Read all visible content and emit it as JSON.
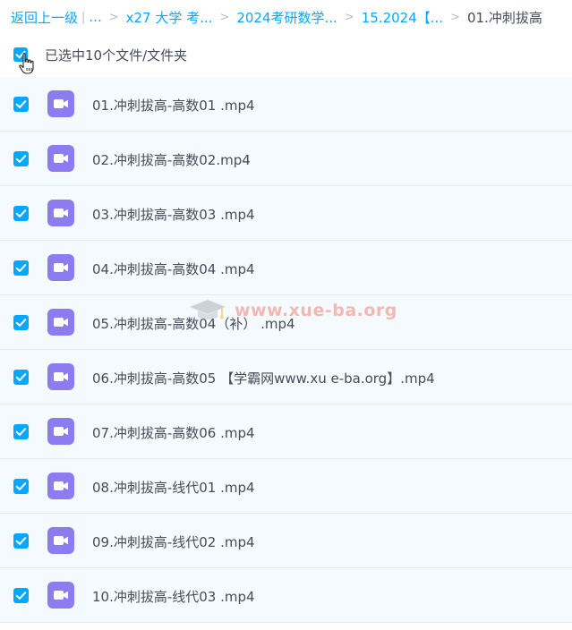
{
  "breadcrumb": {
    "items": [
      {
        "label": "返回上一级"
      },
      {
        "label": "..."
      },
      {
        "label": "x27 大学 考..."
      },
      {
        "label": "2024考研数学..."
      },
      {
        "label": "15.2024【..."
      }
    ],
    "pipe": "|",
    "separator": ">",
    "current": "01.冲刺拔高"
  },
  "selection": {
    "text": "已选中10个文件/文件夹",
    "checked": true
  },
  "files": [
    {
      "name": "01.冲刺拔高-高数01 .mp4",
      "checked": true,
      "icon": "video-file-icon"
    },
    {
      "name": "02.冲刺拔高-高数02.mp4",
      "checked": true,
      "icon": "video-file-icon"
    },
    {
      "name": "03.冲刺拔高-高数03 .mp4",
      "checked": true,
      "icon": "video-file-icon"
    },
    {
      "name": "04.冲刺拔高-高数04 .mp4",
      "checked": true,
      "icon": "video-file-icon"
    },
    {
      "name": "05.冲刺拔高-高数04（补） .mp4",
      "checked": true,
      "icon": "video-file-icon"
    },
    {
      "name": "06.冲刺拔高-高数05 【学霸网www.xu e-ba.org】.mp4",
      "checked": true,
      "icon": "video-file-icon"
    },
    {
      "name": "07.冲刺拔高-高数06 .mp4",
      "checked": true,
      "icon": "video-file-icon"
    },
    {
      "name": "08.冲刺拔高-线代01 .mp4",
      "checked": true,
      "icon": "video-file-icon"
    },
    {
      "name": "09.冲刺拔高-线代02 .mp4",
      "checked": true,
      "icon": "video-file-icon"
    },
    {
      "name": "10.冲刺拔高-线代03 .mp4",
      "checked": true,
      "icon": "video-file-icon"
    }
  ],
  "watermark": {
    "text": "www.xue-ba.org"
  },
  "colors": {
    "accent": "#06a7ff",
    "video_icon": "#8c7cf0",
    "text": "#454d5a",
    "row_bg": "#f5fafe",
    "watermark": "#f06a5a"
  }
}
